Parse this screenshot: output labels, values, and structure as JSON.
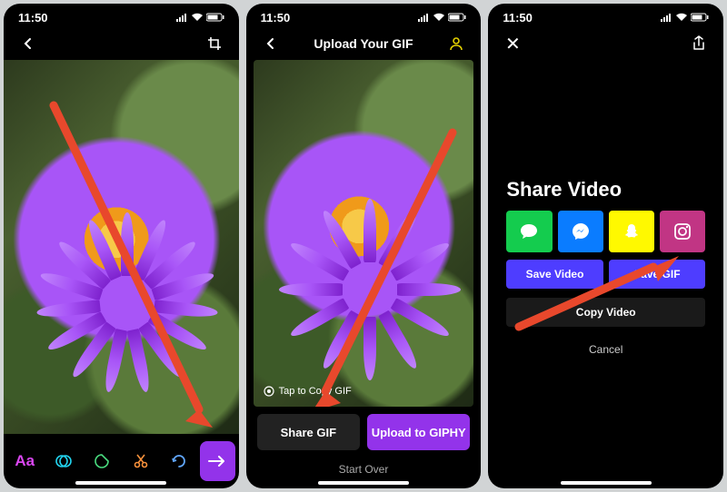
{
  "status": {
    "time": "11:50"
  },
  "panel1": {
    "tools": {
      "aa": "Aa"
    }
  },
  "panel2": {
    "title": "Upload Your GIF",
    "tap_copy": "Tap to Copy GIF",
    "share_btn": "Share GIF",
    "upload_btn": "Upload to GIPHY",
    "start_over": "Start Over"
  },
  "panel3": {
    "share_title": "Share Video",
    "save_video": "Save Video",
    "save_gif": "Save GIF",
    "copy_video": "Copy Video",
    "cancel": "Cancel"
  }
}
